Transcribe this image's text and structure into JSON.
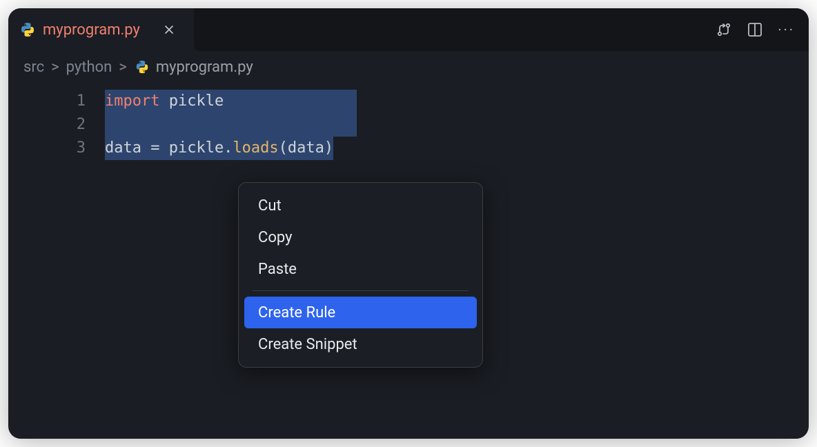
{
  "tab": {
    "filename": "myprogram.py"
  },
  "breadcrumb": {
    "items": [
      "src",
      "python"
    ],
    "file": "myprogram.py"
  },
  "code": {
    "lines": {
      "n1": "1",
      "n2": "2",
      "n3": "3"
    },
    "line1": {
      "kw": "import",
      "rest": " pickle"
    },
    "line3": {
      "a": "data = pickle.",
      "fn": "loads",
      "b": "(data)"
    }
  },
  "context_menu": {
    "cut": "Cut",
    "copy": "Copy",
    "paste": "Paste",
    "create_rule": "Create Rule",
    "create_snippet": "Create Snippet"
  }
}
